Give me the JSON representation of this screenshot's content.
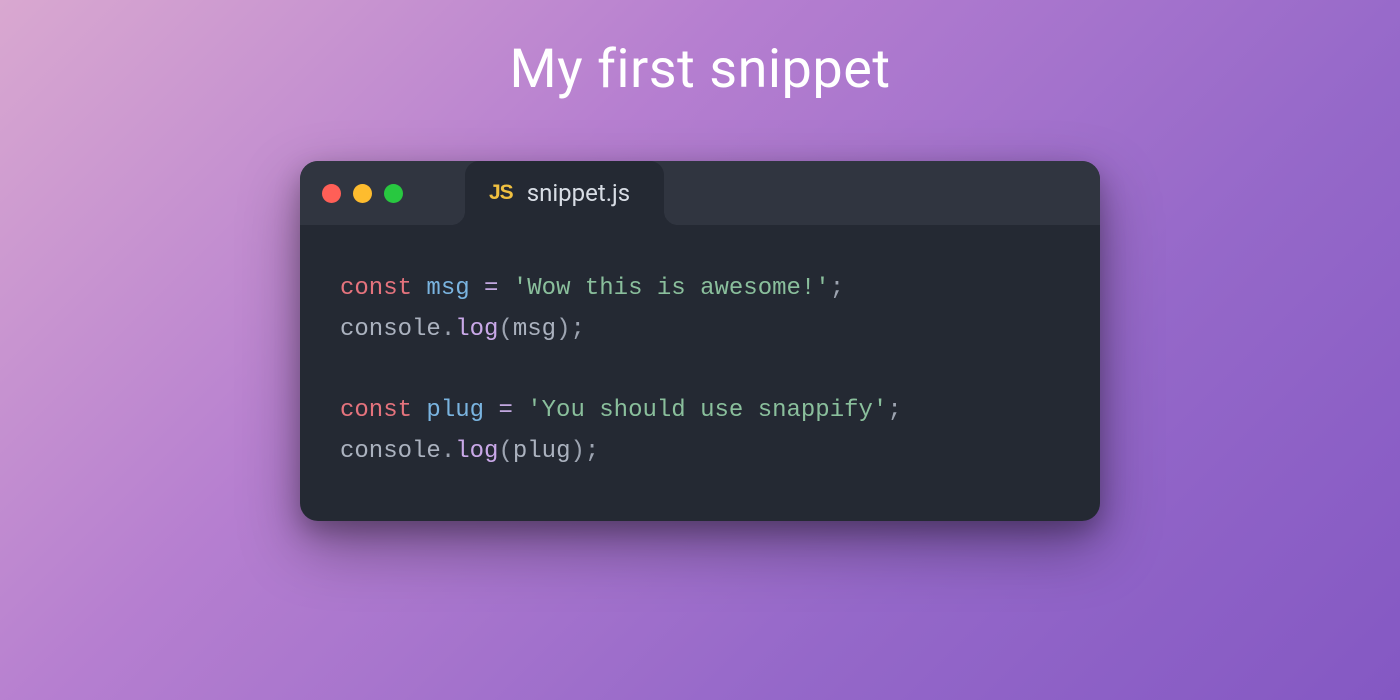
{
  "title": "My first snippet",
  "window": {
    "tab": {
      "badge": "JS",
      "filename": "snippet.js"
    },
    "traffic_lights": {
      "red_name": "close-icon",
      "yellow_name": "minimize-icon",
      "green_name": "maximize-icon"
    }
  },
  "code": {
    "lines": [
      {
        "type": "code",
        "tokens": [
          {
            "cls": "tok-keyword",
            "text": "const"
          },
          {
            "cls": "space",
            "text": " "
          },
          {
            "cls": "tok-varname",
            "text": "msg"
          },
          {
            "cls": "space",
            "text": " "
          },
          {
            "cls": "tok-operator",
            "text": "="
          },
          {
            "cls": "space",
            "text": " "
          },
          {
            "cls": "tok-string",
            "text": "'Wow this is awesome!'"
          },
          {
            "cls": "tok-punct",
            "text": ";"
          }
        ]
      },
      {
        "type": "code",
        "tokens": [
          {
            "cls": "tok-object",
            "text": "console"
          },
          {
            "cls": "tok-punct",
            "text": "."
          },
          {
            "cls": "tok-method",
            "text": "log"
          },
          {
            "cls": "tok-punct",
            "text": "("
          },
          {
            "cls": "tok-object",
            "text": "msg"
          },
          {
            "cls": "tok-punct",
            "text": ");"
          }
        ]
      },
      {
        "type": "blank"
      },
      {
        "type": "code",
        "tokens": [
          {
            "cls": "tok-keyword",
            "text": "const"
          },
          {
            "cls": "space",
            "text": " "
          },
          {
            "cls": "tok-varname",
            "text": "plug"
          },
          {
            "cls": "space",
            "text": " "
          },
          {
            "cls": "tok-operator",
            "text": "="
          },
          {
            "cls": "space",
            "text": " "
          },
          {
            "cls": "tok-string",
            "text": "'You should use snappify'"
          },
          {
            "cls": "tok-punct",
            "text": ";"
          }
        ]
      },
      {
        "type": "code",
        "tokens": [
          {
            "cls": "tok-object",
            "text": "console"
          },
          {
            "cls": "tok-punct",
            "text": "."
          },
          {
            "cls": "tok-method",
            "text": "log"
          },
          {
            "cls": "tok-punct",
            "text": "("
          },
          {
            "cls": "tok-object",
            "text": "plug"
          },
          {
            "cls": "tok-punct",
            "text": ");"
          }
        ]
      }
    ]
  }
}
